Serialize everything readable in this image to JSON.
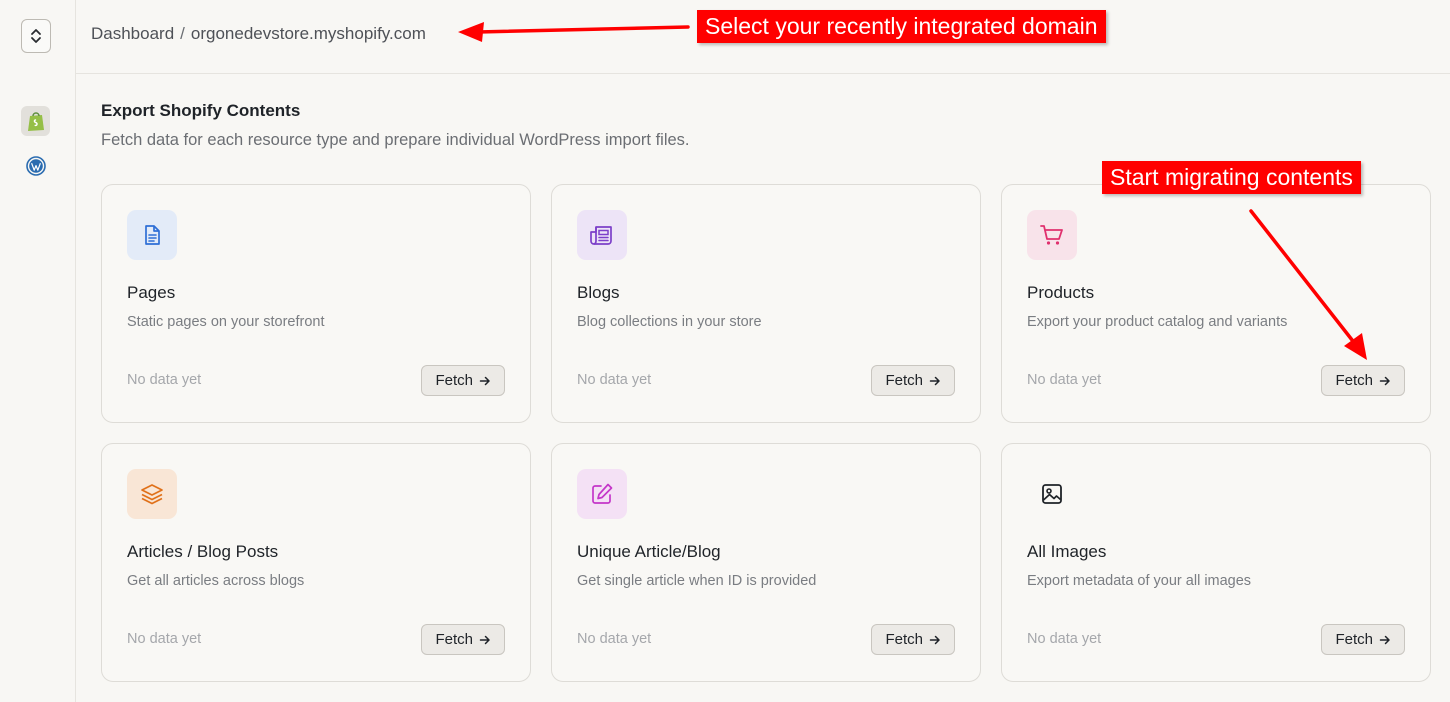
{
  "breadcrumb": {
    "root": "Dashboard",
    "separator": "/",
    "current": "orgonedevstore.myshopify.com"
  },
  "sidebar": {
    "items": [
      {
        "name": "shopify",
        "icon": "shopify-icon"
      },
      {
        "name": "wordpress",
        "icon": "wordpress-icon"
      }
    ]
  },
  "annotations": {
    "domain_hint": "Select your recently integrated domain",
    "migrate_hint": "Start migrating contents"
  },
  "section": {
    "title": "Export Shopify Contents",
    "subtitle": "Fetch data for each resource type and prepare individual WordPress import files."
  },
  "cards": [
    {
      "title": "Pages",
      "description": "Static pages on your storefront",
      "status": "No data yet",
      "button": "Fetch",
      "icon": "document-icon",
      "icon_bg": "#e3ebf8",
      "icon_color": "#2f6fd6"
    },
    {
      "title": "Blogs",
      "description": "Blog collections in your store",
      "status": "No data yet",
      "button": "Fetch",
      "icon": "newspaper-icon",
      "icon_bg": "#ede4f7",
      "icon_color": "#7c3fc9"
    },
    {
      "title": "Products",
      "description": "Export your product catalog and variants",
      "status": "No data yet",
      "button": "Fetch",
      "icon": "cart-icon",
      "icon_bg": "#f8e3ea",
      "icon_color": "#e0306e"
    },
    {
      "title": "Articles / Blog Posts",
      "description": "Get all articles across blogs",
      "status": "No data yet",
      "button": "Fetch",
      "icon": "layers-icon",
      "icon_bg": "#f9e6d6",
      "icon_color": "#e0711a"
    },
    {
      "title": "Unique Article/Blog",
      "description": "Get single article when ID is provided",
      "status": "No data yet",
      "button": "Fetch",
      "icon": "edit-icon",
      "icon_bg": "#f4e1f5",
      "icon_color": "#c436c9"
    },
    {
      "title": "All Images",
      "description": "Export metadata of your all images",
      "status": "No data yet",
      "button": "Fetch",
      "icon": "image-icon",
      "icon_bg": "transparent",
      "icon_color": "#1f2328"
    }
  ]
}
